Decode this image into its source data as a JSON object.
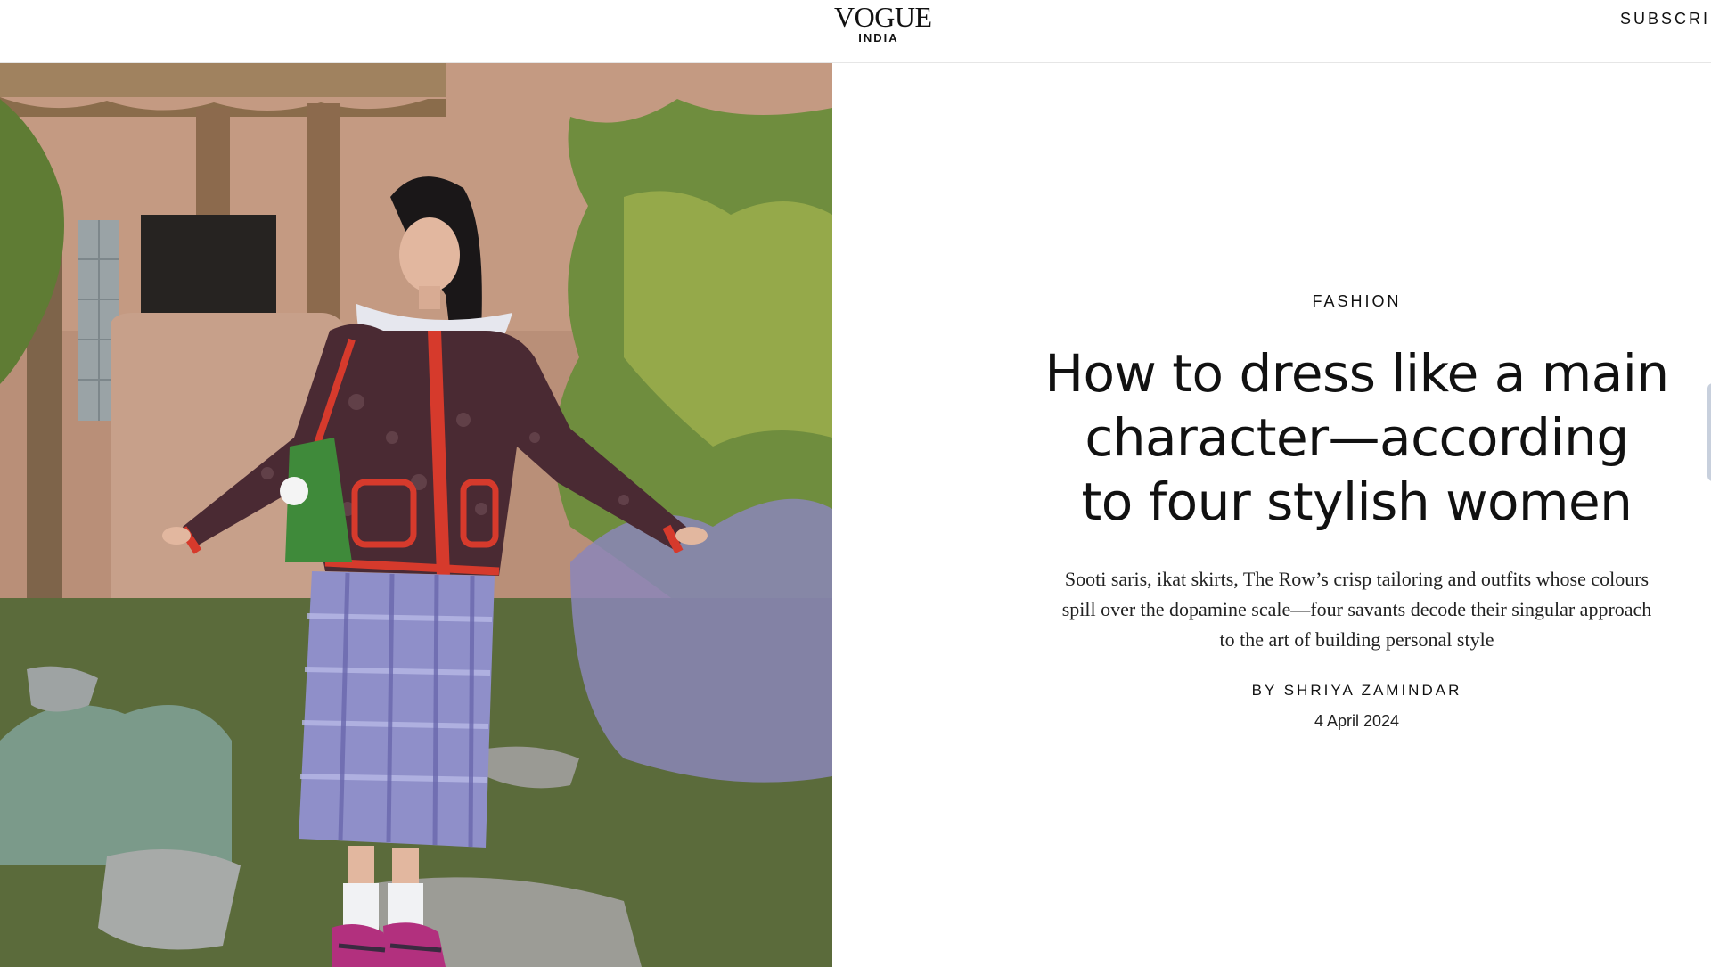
{
  "header": {
    "logo_main": "VOGUE",
    "logo_sub": "INDIA",
    "subscribe_label": "SUBSCRIB"
  },
  "hero": {
    "alt": "Woman in patterned jacket with white collar, plaid skirt and pink sneakers posing with arms outstretched in front of an adobe house"
  },
  "article": {
    "rubric": "FASHION",
    "headline_lines": [
      "How to dress like a main",
      "character—according",
      "to four stylish women"
    ],
    "dek_lines": [
      "Sooti saris, ikat skirts, The Row’s crisp tailoring and outfits whose colours",
      "spill over the dopamine scale—four savants decode their singular approach",
      "to the art of building personal style"
    ],
    "byline_prefix": "BY",
    "author": "SHRIYA ZAMINDAR",
    "date": "4 April 2024"
  },
  "colors": {
    "text": "#111111",
    "background": "#ffffff",
    "divider": "#e6e6e6"
  }
}
